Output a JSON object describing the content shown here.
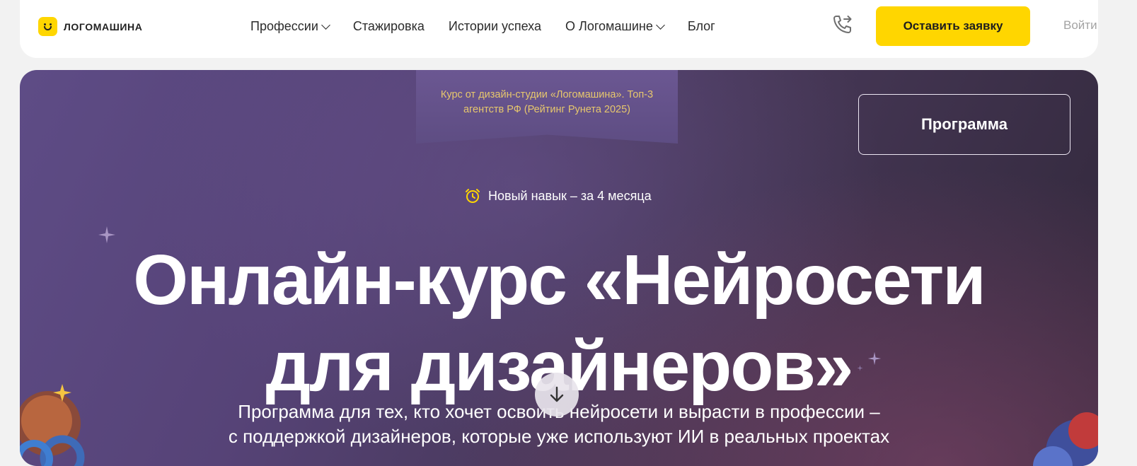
{
  "header": {
    "logo_text": "ЛОГОМАШИНА",
    "nav": [
      {
        "label": "Профессии",
        "has_dropdown": true
      },
      {
        "label": "Стажировка",
        "has_dropdown": false
      },
      {
        "label": "Истории успеха",
        "has_dropdown": false
      },
      {
        "label": "О Логомашине",
        "has_dropdown": true
      },
      {
        "label": "Блог",
        "has_dropdown": false
      }
    ],
    "phone_icon": "phone-forward-icon",
    "cta_label": "Оставить заявку",
    "login_label": "Войти"
  },
  "hero": {
    "ribbon_text": "Курс от дизайн-студии «Логомашина». Топ-3 агентств РФ (Рейтинг Рунета 2025)",
    "program_button": "Программа",
    "skill_text": "Новый навык – за 4 месяца",
    "title_line1": "Онлайн-курс «Нейросети",
    "title_line2": "для дизайнеров»",
    "subtitle_line1": "Программа для тех, кто хочет освоить нейросети и вырасти в профессии –",
    "subtitle_line2": "с поддержкой дизайнеров, которые уже используют ИИ в реальных проектах"
  },
  "colors": {
    "accent_yellow": "#ffd600",
    "hero_purple": "#5e4c86",
    "ribbon_text": "#e7c76d"
  }
}
